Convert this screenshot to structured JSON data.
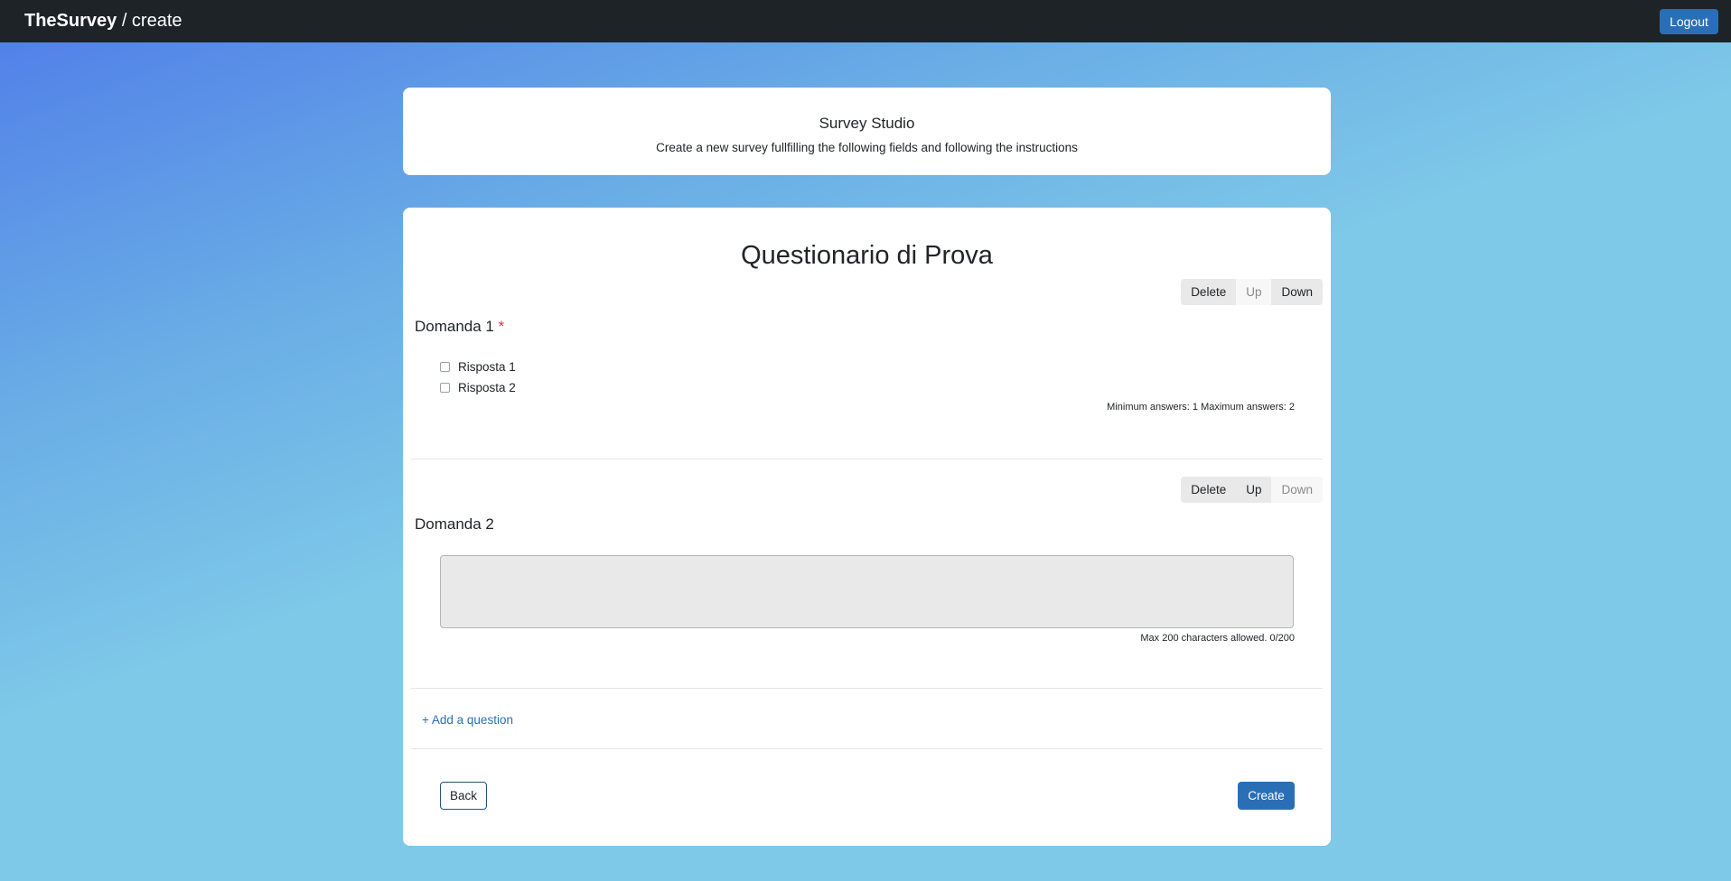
{
  "navbar": {
    "brand_bold": "TheSurvey",
    "brand_rest": " / create",
    "logout_label": "Logout"
  },
  "header": {
    "title": "Survey Studio",
    "subtitle": "Create a new survey fullfilling the following fields and following the instructions"
  },
  "survey": {
    "title": "Questionario di Prova",
    "questions": [
      {
        "title": "Domanda 1",
        "required_mark": "*",
        "controls": {
          "delete": "Delete",
          "up": "Up",
          "down": "Down"
        },
        "options": [
          "Risposta 1",
          "Risposta 2"
        ],
        "note": "Minimum answers: 1 Maximum answers: 2"
      },
      {
        "title": "Domanda 2",
        "controls": {
          "delete": "Delete",
          "up": "Up",
          "down": "Down"
        },
        "note": "Max 200 characters allowed. 0/200"
      }
    ],
    "add_question_label": "+ Add a question",
    "back_label": "Back",
    "create_label": "Create"
  },
  "colors": {
    "navbar": "#1e2328",
    "primary": "#2a6fb6",
    "required": "#dc3545"
  }
}
